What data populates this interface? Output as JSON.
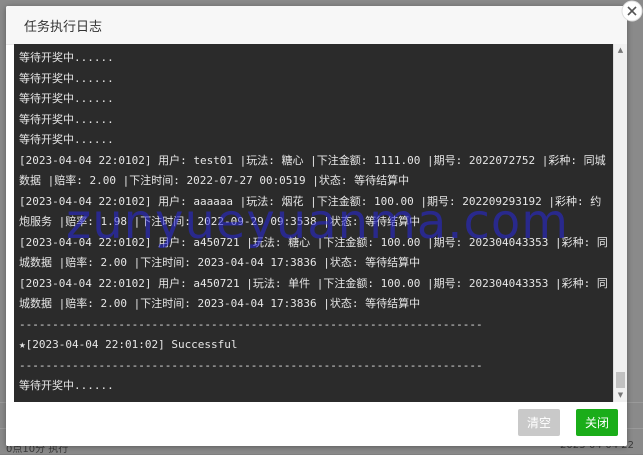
{
  "modal": {
    "title": "任务执行日志",
    "buttons": {
      "clear": "清空",
      "close": "关闭"
    }
  },
  "log_lines": [
    "等待开奖中......",
    "等待开奖中......",
    "等待开奖中......",
    "等待开奖中......",
    "等待开奖中......",
    "[2023-04-04 22:0102] 用户: test01 |玩法: 糖心 |下注金额: 1111.00 |期号: 2022072752 |彩种: 同城数据 |赔率: 2.00 |下注时间: 2022-07-27 00:0519 |状态: 等待结算中",
    "[2023-04-04 22:0102] 用户: aaaaaa |玩法: 烟花 |下注金额: 100.00 |期号: 202209293192 |彩种: 约炮服务 |赔率: 1.98 |下注时间: 2022-09-29 09:3538 |状态: 等待结算中",
    "[2023-04-04 22:0102] 用户: a450721 |玩法: 糖心 |下注金额: 100.00 |期号: 202304043353 |彩种: 同城数据 |赔率: 2.00 |下注时间: 2023-04-04 17:3836 |状态: 等待结算中",
    "[2023-04-04 22:0102] 用户: a450721 |玩法: 单件 |下注金额: 100.00 |期号: 202304043353 |彩种: 同城数据 |赔率: 2.00 |下注时间: 2023-04-04 17:3836 |状态: 等待结算中",
    "----------------------------------------------------------------------",
    "★[2023-04-04 22:01:02] Successful",
    "----------------------------------------------------------------------",
    "等待开奖中......"
  ],
  "watermark": "zunyueyuanma.com",
  "background_fragments": {
    "right_date": "2023-04-04 22",
    "left_text": "0点10分 执行"
  },
  "colors": {
    "log_background": "#2b2b2b",
    "log_text": "#e6e6e6",
    "close_button": "#1aad19",
    "clear_button": "#c9c9c9",
    "watermark": "#2828dc"
  }
}
